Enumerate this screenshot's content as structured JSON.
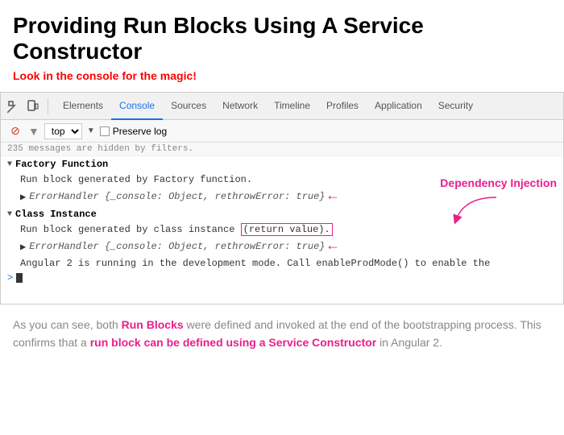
{
  "page": {
    "title": "Providing Run Blocks Using A Service Constructor",
    "subtitle_text": "Look in the console for the magic",
    "subtitle_exclamation": "!"
  },
  "devtools": {
    "tabs": [
      {
        "label": "Elements",
        "active": false
      },
      {
        "label": "Console",
        "active": true
      },
      {
        "label": "Sources",
        "active": false
      },
      {
        "label": "Network",
        "active": false
      },
      {
        "label": "Timeline",
        "active": false
      },
      {
        "label": "Profiles",
        "active": false
      },
      {
        "label": "Application",
        "active": false
      },
      {
        "label": "Security",
        "active": false
      }
    ],
    "filter_bar": {
      "select_label": "top",
      "preserve_log": "Preserve log"
    },
    "console_info": "235 messages are hidden by filters.",
    "dependency_injection_label": "Dependency Injection",
    "groups": [
      {
        "name": "Factory Function",
        "lines": [
          "Run block generated by Factory function.",
          "▶ ErrorHandler {_console: Object, rethrowError: true}"
        ]
      },
      {
        "name": "Class Instance",
        "lines": [
          "Run block generated by class instance",
          "▶ ErrorHandler {_console: Object, rethrowError: true}"
        ]
      }
    ],
    "angular_line": "Angular 2 is running in the development mode. Call enableProdMode() to enable the"
  },
  "bottom_paragraph": {
    "text_start": "As you can see, both ",
    "run_blocks_bold": "Run Blocks",
    "text_mid": " were defined and invoked at the end of the bootstrapping process. This confirms that a ",
    "run_block_inline": "run block can be defined using a Service Constructor",
    "text_end": " in Angular 2."
  }
}
